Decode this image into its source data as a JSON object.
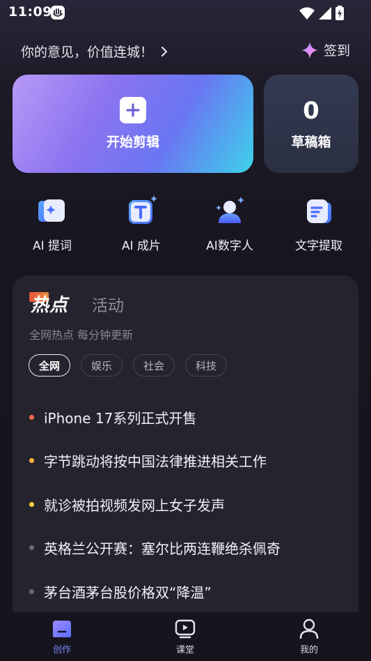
{
  "status_bar": {
    "time": "11:09"
  },
  "header": {
    "feedback_text": "你的意见，价值连城！",
    "checkin_label": "签到"
  },
  "start_card": {
    "label": "开始剪辑"
  },
  "draft_card": {
    "count": "0",
    "label": "草稿箱"
  },
  "tools": [
    {
      "label": "AI 提词",
      "icon": "ai-prompt-icon"
    },
    {
      "label": "AI 成片",
      "icon": "ai-video-icon"
    },
    {
      "label": "AI数字人",
      "icon": "ai-avatar-icon"
    },
    {
      "label": "文字提取",
      "icon": "text-extract-icon"
    }
  ],
  "hot_panel": {
    "tabs": {
      "hot": "热点",
      "activity": "活动"
    },
    "subtitle": "全网热点 每分钟更新",
    "chips": [
      "全网",
      "娱乐",
      "社会",
      "科技"
    ],
    "news": [
      {
        "text": "iPhone 17系列正式开售",
        "dot_color": "#ff6a4a"
      },
      {
        "text": "字节跳动将按中国法律推进相关工作",
        "dot_color": "#ffb23a"
      },
      {
        "text": "就诊被拍视频发网上女子发声",
        "dot_color": "#ffd23a"
      },
      {
        "text": "英格兰公开赛：塞尔比两连鞭绝杀佩奇",
        "dot_color": "#6b6880"
      },
      {
        "text": "茅台酒茅台股价格双“降温”",
        "dot_color": "#6b6880"
      }
    ]
  },
  "bottom_nav": [
    {
      "label": "创作",
      "icon": "create-icon",
      "active": true
    },
    {
      "label": "课堂",
      "icon": "classroom-icon",
      "active": false
    },
    {
      "label": "我的",
      "icon": "profile-icon",
      "active": false
    }
  ],
  "colors": {
    "accent": "#7a87ff",
    "background": "#17151f",
    "panel": "#25232e"
  }
}
